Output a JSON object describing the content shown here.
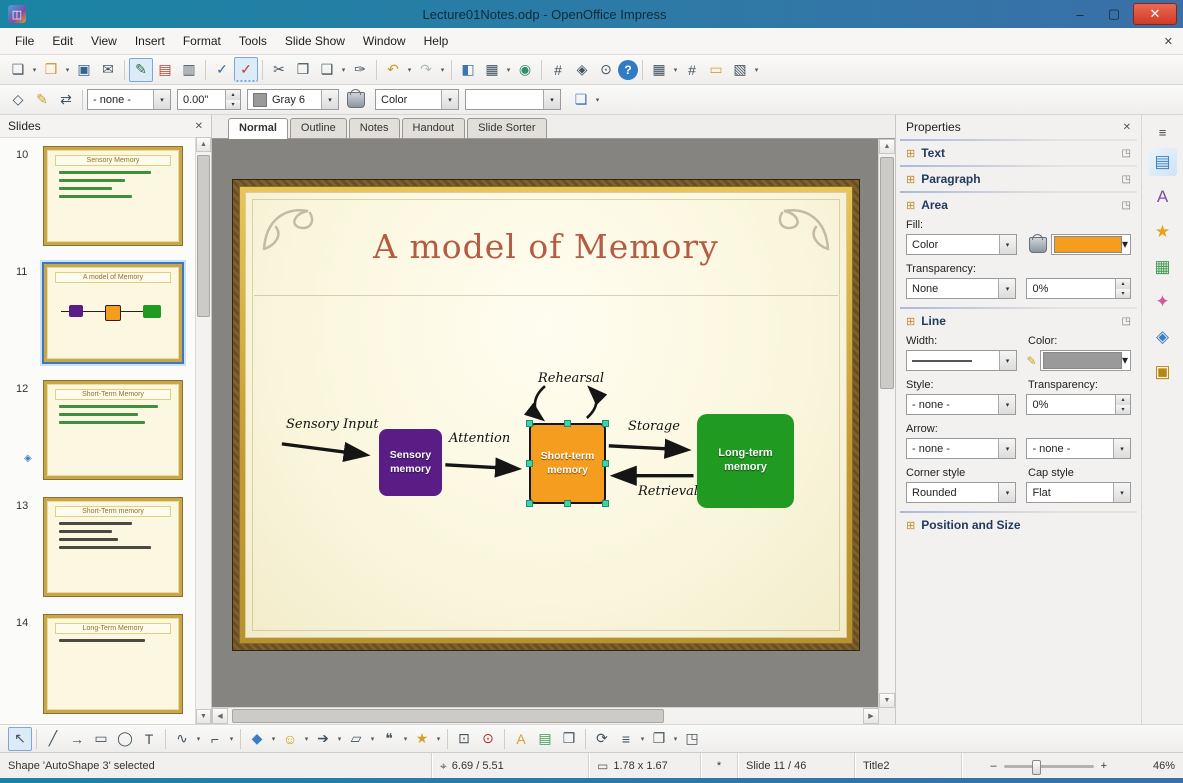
{
  "window": {
    "title": "Lecture01Notes.odp - OpenOffice Impress"
  },
  "menubar": {
    "items": [
      "File",
      "Edit",
      "View",
      "Insert",
      "Format",
      "Tools",
      "Slide Show",
      "Window",
      "Help"
    ]
  },
  "view_tabs": {
    "tabs": [
      "Normal",
      "Outline",
      "Notes",
      "Handout",
      "Slide Sorter"
    ]
  },
  "toolbar_line": {
    "line_style": "- none -",
    "line_width": "0.00\"",
    "line_color_name": "Gray 6",
    "fill_type": "Color"
  },
  "slides_panel": {
    "title": "Slides",
    "slides": [
      {
        "num": "10",
        "title": "Sensory Memory"
      },
      {
        "num": "11",
        "title": "A model of Memory"
      },
      {
        "num": "12",
        "title": "Short-Term Memory"
      },
      {
        "num": "13",
        "title": "Short-Term memory"
      },
      {
        "num": "14",
        "title": "Long-Term Memory"
      }
    ]
  },
  "slide": {
    "title": "A model of Memory",
    "diagram": {
      "sensory_input": "Sensory Input",
      "attention": "Attention",
      "rehearsal": "Rehearsal",
      "storage": "Storage",
      "retrieval": "Retrieval",
      "boxes": [
        {
          "label": "Sensory memory",
          "color": "#5a1d86"
        },
        {
          "label": "Short-term memory",
          "color": "#f59d1e"
        },
        {
          "label": "Long-term memory",
          "color": "#219a21"
        }
      ]
    }
  },
  "properties": {
    "title": "Properties",
    "sections": {
      "text": "Text",
      "paragraph": "Paragraph",
      "area": "Area",
      "line": "Line",
      "possize": "Position and Size"
    },
    "area": {
      "fill_label": "Fill:",
      "fill_type": "Color",
      "fill_color": "#f59d1e",
      "transparency_label": "Transparency:",
      "transparency_type": "None",
      "transparency_value": "0%"
    },
    "line": {
      "width_label": "Width:",
      "color_label": "Color:",
      "color_value": "#9a9a9a",
      "style_label": "Style:",
      "style_value": "- none -",
      "transparency_label": "Transparency:",
      "transparency_value": "0%",
      "arrow_label": "Arrow:",
      "arrow_start": "- none -",
      "arrow_end": "- none -",
      "corner_label": "Corner style",
      "corner_value": "Rounded",
      "cap_label": "Cap style",
      "cap_value": "Flat"
    }
  },
  "statusbar": {
    "selection": "Shape 'AutoShape 3' selected",
    "position": "6.69 / 5.51",
    "size": "1.78 x 1.67",
    "modified": "*",
    "slide": "Slide 11 / 46",
    "layout": "Title2",
    "zoom": "46%"
  },
  "colors": {
    "handle": "#3ed3a8",
    "selection": "#3b78c4"
  },
  "icons": {
    "close": "✕",
    "minimize": "–",
    "maximize": "▢",
    "app": "◫",
    "new": "❏",
    "open": "❒",
    "save": "▣",
    "email": "✉",
    "edit": "✎",
    "pdf": "▤",
    "print": "▥",
    "spelling": "✓",
    "autospell": "✓",
    "cut": "✂",
    "copy": "❐",
    "paste": "❑",
    "clone": "✑",
    "undo": "↶",
    "redo": "↷",
    "chart": "◧",
    "table": "▦",
    "hyperlink": "◉",
    "grid": "#",
    "navigator": "◈",
    "zoom": "⊙",
    "help": "?",
    "insert_table": "▦",
    "show_grid": "#",
    "gallery": "▭",
    "slideshow": "▧",
    "dropdown": "▾",
    "overflow": "»",
    "edit_points": "◇",
    "line_props": "✎",
    "arrow_style": "⇄",
    "shadow": "❏",
    "spin_up": "▴",
    "spin_down": "▾",
    "up": "▲",
    "down": "▼",
    "left": "◀",
    "right": "▶",
    "section_expand": "⊞",
    "dialog_launcher": "◳",
    "sb_menu": "≡",
    "tab_props": "▤",
    "tab_styles": "A",
    "tab_gallery": "★",
    "tab_images": "▦",
    "tab_anim": "✦",
    "tab_trans": "◈",
    "tab_master": "▣",
    "d_select": "↖",
    "d_line": "╱",
    "d_arrow": "→",
    "d_rect": "▭",
    "d_ellipse": "◯",
    "d_text": "T",
    "d_curve": "∿",
    "d_connector": "⌐",
    "d_shapes": "◆",
    "d_smiley": "☺",
    "d_blockarrow": "➔",
    "d_flowchart": "▱",
    "d_callout": "❝",
    "d_star": "★",
    "d_points": "⊡",
    "d_glue": "⊙",
    "d_fontwork": "A",
    "d_fromfile": "▤",
    "d_gallery": "❒",
    "d_rotate": "⟳",
    "d_align": "≡",
    "d_arrange": "❐",
    "d_extrude": "◳",
    "pos": "⌖",
    "size": "▭",
    "transition_ind": "◈"
  }
}
